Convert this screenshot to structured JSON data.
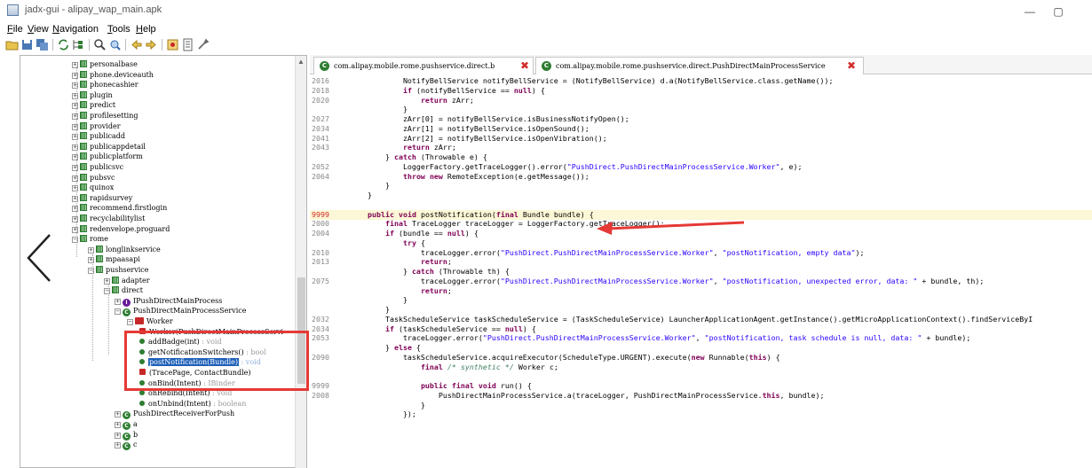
{
  "window": {
    "title": "jadx-gui - alipay_wap_main.apk",
    "minimize": "—",
    "maximize": "▢"
  },
  "menu": [
    {
      "acc": "F",
      "rest": "ile"
    },
    {
      "acc": "V",
      "rest": "iew"
    },
    {
      "acc": "N",
      "rest": "avigation"
    },
    {
      "acc": "T",
      "rest": "ools"
    },
    {
      "acc": "H",
      "rest": "elp"
    }
  ],
  "toolbar": {
    "icons": [
      "open-icon",
      "save-icon",
      "save-all-icon",
      "sync-icon",
      "tree-icon",
      "search-icon",
      "find-icon",
      "back-icon",
      "forward-icon",
      "deobfuscate-icon",
      "log-icon",
      "settings-icon"
    ]
  },
  "tree": {
    "items": [
      {
        "label": "personalbase",
        "kind": "pkg",
        "exp": "+"
      },
      {
        "label": "phone.deviceauth",
        "kind": "pkg",
        "exp": "+"
      },
      {
        "label": "phonecashier",
        "kind": "pkg",
        "exp": "+"
      },
      {
        "label": "plugin",
        "kind": "pkg",
        "exp": "+"
      },
      {
        "label": "predict",
        "kind": "pkg",
        "exp": "+"
      },
      {
        "label": "profilesetting",
        "kind": "pkg",
        "exp": "+"
      },
      {
        "label": "provider",
        "kind": "pkg",
        "exp": "+"
      },
      {
        "label": "publicadd",
        "kind": "pkg",
        "exp": "+"
      },
      {
        "label": "publicappdetail",
        "kind": "pkg",
        "exp": "+"
      },
      {
        "label": "publicplatform",
        "kind": "pkg",
        "exp": "+"
      },
      {
        "label": "publicsvc",
        "kind": "pkg",
        "exp": "+"
      },
      {
        "label": "pubsvc",
        "kind": "pkg",
        "exp": "+"
      },
      {
        "label": "quinox",
        "kind": "pkg",
        "exp": "+"
      },
      {
        "label": "rapidsurvey",
        "kind": "pkg",
        "exp": "+"
      },
      {
        "label": "recommend.firstlogin",
        "kind": "pkg",
        "exp": "+"
      },
      {
        "label": "recyclabilitylist",
        "kind": "pkg",
        "exp": "+"
      },
      {
        "label": "redenvelope.proguard",
        "kind": "pkg",
        "exp": "+"
      },
      {
        "label": "rome",
        "kind": "pkg",
        "exp": "−"
      },
      {
        "label": "longlinkservice",
        "kind": "pkg",
        "exp": "+"
      },
      {
        "label": "mpaasapi",
        "kind": "pkg",
        "exp": "+"
      },
      {
        "label": "pushservice",
        "kind": "pkg",
        "exp": "−"
      },
      {
        "label": "adapter",
        "kind": "pkg",
        "exp": "+"
      },
      {
        "label": "direct",
        "kind": "pkg",
        "exp": "−"
      },
      {
        "label": "IPushDirectMainProcess",
        "kind": "ifc",
        "exp": "+"
      },
      {
        "label": "PushDirectMainProcessService",
        "kind": "cls",
        "exp": "−"
      },
      {
        "label": "Worker",
        "kind": "worker",
        "exp": "−"
      },
      {
        "label": "Worker(PushDirectMainProcessServi",
        "kind": "ctor",
        "ret": ""
      },
      {
        "label": "addBadge(int)",
        "kind": "mth",
        "ret": "void"
      },
      {
        "label": "getNotificationSwitchers()",
        "kind": "mth",
        "ret": "bool"
      },
      {
        "label": "postNotification(Bundle)",
        "kind": "mth",
        "ret": "void",
        "selected": true
      },
      {
        "label": "(TracePage, ContactBundle)",
        "kind": "ctor",
        "ret": ""
      },
      {
        "label": "onBind(Intent)",
        "kind": "mth",
        "ret": "IBinder"
      },
      {
        "label": "onRebind(Intent)",
        "kind": "mth",
        "ret": "void"
      },
      {
        "label": "onUnbind(Intent)",
        "kind": "mth",
        "ret": "boolean"
      },
      {
        "label": "PushDirectReceiverForPush",
        "kind": "cls",
        "exp": "+"
      },
      {
        "label": "a",
        "kind": "cls",
        "exp": "+"
      },
      {
        "label": "b",
        "kind": "cls",
        "exp": "+"
      },
      {
        "label": "c",
        "kind": "cls",
        "exp": "+"
      }
    ]
  },
  "tabs": [
    {
      "label": "com.alipay.mobile.rome.pushservice.direct.b",
      "close": "✖"
    },
    {
      "label": "com.alipay.mobile.rome.pushservice.direct.PushDirectMainProcessService",
      "close": "✖"
    }
  ],
  "code": {
    "lines": [
      {
        "n": "2016",
        "t": "            NotifyBellService notifyBellService = (NotifyBellService) d.a(NotifyBellService.class.getName());"
      },
      {
        "n": "2018",
        "t": "            if (notifyBellService == null) {"
      },
      {
        "n": "2020",
        "t": "                return zArr;"
      },
      {
        "n": "",
        "t": "            }"
      },
      {
        "n": "2027",
        "t": "            zArr[0] = notifyBellService.isBusinessNotifyOpen();"
      },
      {
        "n": "2034",
        "t": "            zArr[1] = notifyBellService.isOpenSound();"
      },
      {
        "n": "2041",
        "t": "            zArr[2] = notifyBellService.isOpenVibration();"
      },
      {
        "n": "2043",
        "t": "            return zArr;"
      },
      {
        "n": "",
        "t": "        } catch (Throwable e) {"
      },
      {
        "n": "2052",
        "t": "            LoggerFactory.getTraceLogger().error(\"PushDirect.PushDirectMainProcessService.Worker\", e);"
      },
      {
        "n": "2064",
        "t": "            throw new RemoteException(e.getMessage());"
      },
      {
        "n": "",
        "t": "        }"
      },
      {
        "n": "",
        "t": "    }"
      },
      {
        "n": "",
        "t": ""
      },
      {
        "n": "9999",
        "t": "    public void postNotification(final Bundle bundle) {",
        "hl": true
      },
      {
        "n": "2000",
        "t": "        final TraceLogger traceLogger = LoggerFactory.getTraceLogger();"
      },
      {
        "n": "2004",
        "t": "        if (bundle == null) {"
      },
      {
        "n": "",
        "t": "            try {"
      },
      {
        "n": "2010",
        "t": "                traceLogger.error(\"PushDirect.PushDirectMainProcessService.Worker\", \"postNotification, empty data\");"
      },
      {
        "n": "2013",
        "t": "                return;"
      },
      {
        "n": "",
        "t": "            } catch (Throwable th) {"
      },
      {
        "n": "2075",
        "t": "                traceLogger.error(\"PushDirect.PushDirectMainProcessService.Worker\", \"postNotification, unexpected error, data: \" + bundle, th);"
      },
      {
        "n": "",
        "t": "                return;"
      },
      {
        "n": "",
        "t": "            }"
      },
      {
        "n": "",
        "t": "        }"
      },
      {
        "n": "2032",
        "t": "        TaskScheduleService taskScheduleService = (TaskScheduleService) LauncherApplicationAgent.getInstance().getMicroApplicationContext().findServiceByI"
      },
      {
        "n": "2034",
        "t": "        if (taskScheduleService == null) {"
      },
      {
        "n": "2053",
        "t": "            traceLogger.error(\"PushDirect.PushDirectMainProcessService.Worker\", \"postNotification, task schedule is null, data: \" + bundle);"
      },
      {
        "n": "",
        "t": "        } else {"
      },
      {
        "n": "2090",
        "t": "            taskScheduleService.acquireExecutor(ScheduleType.URGENT).execute(new Runnable(this) {"
      },
      {
        "n": "",
        "t": "                final /* synthetic */ Worker c;"
      },
      {
        "n": "",
        "t": ""
      },
      {
        "n": "9999",
        "t": "                public final void run() {"
      },
      {
        "n": "2008",
        "t": "                    PushDirectMainProcessService.a(traceLogger, PushDirectMainProcessService.this, bundle);"
      },
      {
        "n": "",
        "t": "                }"
      },
      {
        "n": "",
        "t": "            });"
      }
    ]
  },
  "colors": {
    "accent_red": "#e53935",
    "selection": "#1e5fb8",
    "highlight_line": "#fcf7d6"
  }
}
